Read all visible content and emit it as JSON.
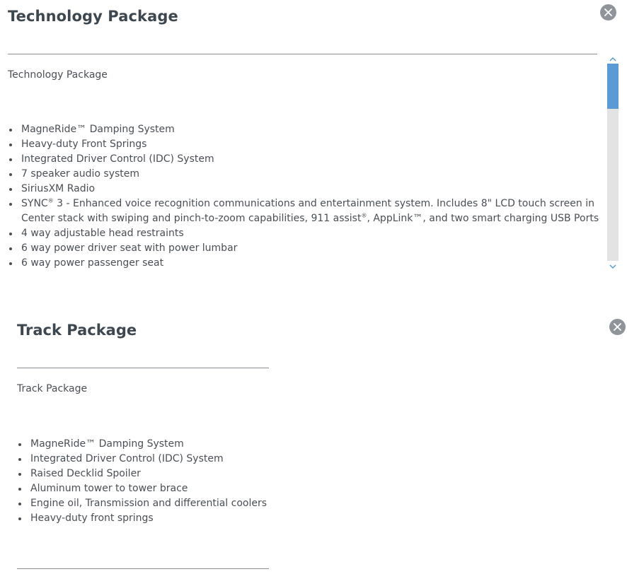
{
  "technology": {
    "title": "Technology Package",
    "subtitle": "Technology Package",
    "features": [
      "MagneRide™ Damping System",
      "Heavy-duty Front Springs",
      "Integrated Driver Control (IDC) System",
      "7 speaker audio system",
      "SiriusXM Radio",
      "SYNC® 3 - Enhanced voice recognition communications and entertainment system. Includes 8\" LCD touch screen in Center stack with swiping and pinch-to-zoom capabilities, 911 assist®, AppLink™, and two smart charging USB Ports",
      "4 way adjustable head restraints",
      "6 way power driver seat with power lumbar",
      "6 way power passenger seat"
    ],
    "sync_feature": {
      "part1": "SYNC",
      "sup1": "®",
      "part2": " 3 - Enhanced voice recognition communications and entertainment system. Includes 8\" LCD touch screen in Center stack with swiping and pinch-to-zoom capabilities, 911 assist",
      "sup2": "®",
      "part3": ", AppLink™, and two smart charging USB Ports"
    }
  },
  "track": {
    "title": "Track Package",
    "subtitle": "Track Package",
    "features": [
      "MagneRide™ Damping System",
      "Integrated Driver Control (IDC) System",
      "Raised Decklid Spoiler",
      "Aluminum tower to tower brace",
      "Engine oil, Transmission and differential coolers",
      "Heavy-duty front springs"
    ]
  },
  "icons": {
    "close": "close-icon",
    "scroll_up": "chevron-up-icon",
    "scroll_down": "chevron-down-icon"
  },
  "colors": {
    "close_button": "#8e949a",
    "scroll_thumb": "#5b9bd5",
    "title": "#3d4750",
    "text": "#4a4f55"
  }
}
